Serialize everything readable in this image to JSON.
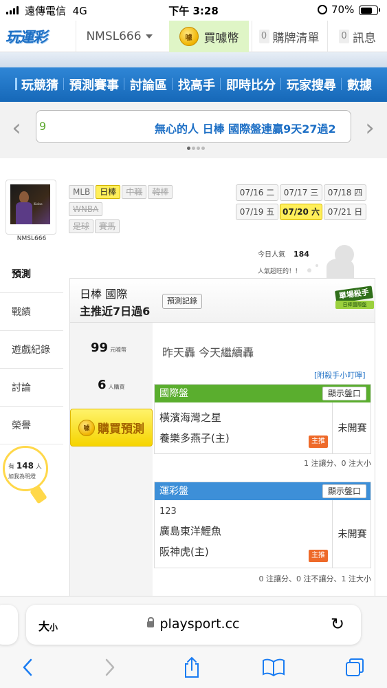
{
  "status_bar": {
    "carrier": "遠傳電信",
    "network": "4G",
    "time": "下午 3:28",
    "battery": "70%",
    "battery_level": 0.7
  },
  "header": {
    "logo_text": "玩運彩",
    "username": "NMSL666",
    "buy_coin": "買噱幣",
    "coin_icon_text": "噱",
    "cart_count": "0",
    "cart_label": "購牌清單",
    "msg_count": "0",
    "msg_label": "訊息"
  },
  "nav": {
    "items": [
      "玩競猜",
      "預測賽事",
      "討論區",
      "找高手",
      "即時比分",
      "玩家搜尋",
      "數據"
    ]
  },
  "ticker": {
    "left_fragment": "9",
    "text": "無心的人 日棒 國際盤連贏9天27過2"
  },
  "sidebar": {
    "username": "NMSL666",
    "tabs": [
      "預測",
      "戰績",
      "遊戲紀錄",
      "討論",
      "榮譽"
    ],
    "fans_prefix": "有",
    "fans_count": "148",
    "fans_suffix": "人",
    "fans_note": "加我為明燈"
  },
  "leagues": {
    "items": [
      {
        "label": "MLB",
        "state": "normal"
      },
      {
        "label": "日棒",
        "state": "active"
      },
      {
        "label": "中職",
        "state": "dim"
      },
      {
        "label": "韓棒",
        "state": "dim"
      },
      {
        "label": "WNBA",
        "state": "dim"
      },
      {
        "label": "足球",
        "state": "dim"
      },
      {
        "label": "賽馬",
        "state": "dim"
      }
    ]
  },
  "dates": {
    "items": [
      {
        "label": "07/16 二",
        "active": false
      },
      {
        "label": "07/17 三",
        "active": false
      },
      {
        "label": "07/18 四",
        "active": false
      },
      {
        "label": "07/19 五",
        "active": false
      },
      {
        "label": "07/20 六",
        "active": true
      },
      {
        "label": "07/21 日",
        "active": false
      }
    ]
  },
  "popularity": {
    "label": "今日人氣",
    "value": "184",
    "note": "人氣超旺的！！"
  },
  "panel": {
    "league_line": "日棒 國際",
    "record_line": "主推近7日過6",
    "record_button": "預測記錄",
    "badge_top": "單場殺手",
    "badge_bottom": "日棒國際盤",
    "price": "99",
    "price_unit": "元噱幣",
    "buyers": "6",
    "buyers_unit": "人購買",
    "buy_button": "購買預測",
    "comment": "昨天轟 今天繼續轟",
    "killer_note": "[附殺手小叮嚀]"
  },
  "markets": [
    {
      "name": "國際盤",
      "color": "#5aae2e",
      "show_button": "顯示盤口",
      "code": "",
      "team1": "橫濱海灣之星",
      "team2": "養樂多燕子(主)",
      "host_tag": "主推",
      "status": "未開賽",
      "footer": "1 注讓分、0 注大小"
    },
    {
      "name": "運彩盤",
      "color": "#3d8fd8",
      "show_button": "顯示盤口",
      "code": "123",
      "team1": "廣島東洋鯉魚",
      "team2": "阪神虎(主)",
      "host_tag": "主推",
      "status": "未開賽",
      "footer": "0 注讓分、0 注不讓分、1 注大小"
    }
  ],
  "safari": {
    "text_size": "大",
    "text_size_small": "小",
    "url": "playsport.cc"
  },
  "icons": {
    "back": "chevron-left-icon",
    "forward": "chevron-right-icon",
    "share": "share-icon",
    "bookmarks": "book-icon",
    "tabs": "tabs-icon"
  }
}
